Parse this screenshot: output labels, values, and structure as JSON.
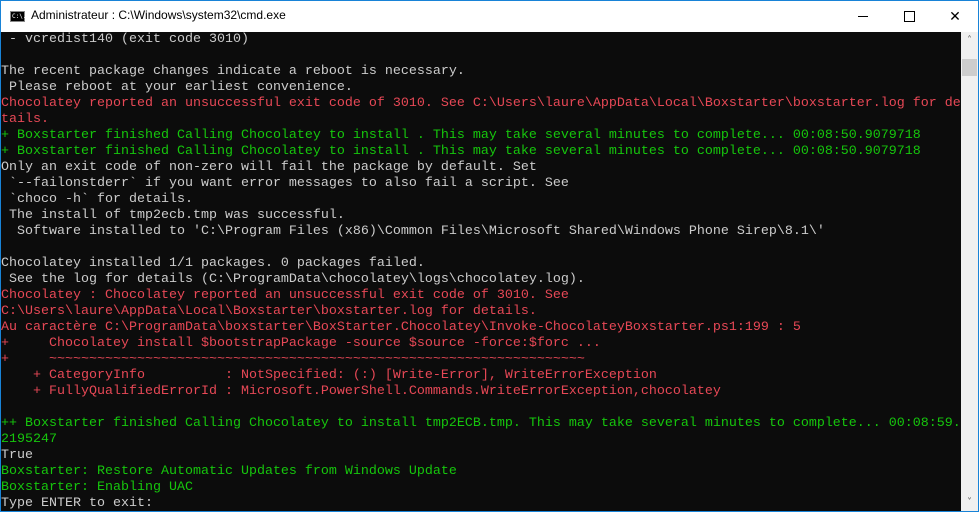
{
  "window": {
    "title": "Administrateur : C:\\Windows\\system32\\cmd.exe",
    "icon": "cmd-icon",
    "icon_text": "C:\\."
  },
  "controls": {
    "minimize": "minimize-icon",
    "maximize": "maximize-icon",
    "close": "close-icon",
    "close_glyph": "✕"
  },
  "scrollbar": {
    "up": "˄",
    "down": "˅"
  },
  "colors": {
    "background": "#0c0c0c",
    "text": "#cccccc",
    "error": "#e74856",
    "success": "#16c60c",
    "border": "#1883d7"
  },
  "console": {
    "lines": [
      {
        "text": " - vcredist140 (exit code 3010)",
        "color": "default"
      },
      {
        "text": "",
        "color": "default"
      },
      {
        "text": "The recent package changes indicate a reboot is necessary.",
        "color": "default"
      },
      {
        "text": " Please reboot at your earliest convenience.",
        "color": "default"
      },
      {
        "text": "Chocolatey reported an unsuccessful exit code of 3010. See C:\\Users\\laure\\AppData\\Local\\Boxstarter\\boxstarter.log for de",
        "color": "red"
      },
      {
        "text": "tails.",
        "color": "red"
      },
      {
        "text": "+ Boxstarter finished Calling Chocolatey to install . This may take several minutes to complete... 00:08:50.9079718",
        "color": "green"
      },
      {
        "text": "+ Boxstarter finished Calling Chocolatey to install . This may take several minutes to complete... 00:08:50.9079718",
        "color": "green"
      },
      {
        "text": "Only an exit code of non-zero will fail the package by default. Set",
        "color": "default"
      },
      {
        "text": " `--failonstderr` if you want error messages to also fail a script. See",
        "color": "default"
      },
      {
        "text": " `choco -h` for details.",
        "color": "default"
      },
      {
        "text": " The install of tmp2ecb.tmp was successful.",
        "color": "default"
      },
      {
        "text": "  Software installed to 'C:\\Program Files (x86)\\Common Files\\Microsoft Shared\\Windows Phone Sirep\\8.1\\'",
        "color": "default"
      },
      {
        "text": "",
        "color": "default"
      },
      {
        "text": "Chocolatey installed 1/1 packages. 0 packages failed.",
        "color": "default"
      },
      {
        "text": " See the log for details (C:\\ProgramData\\chocolatey\\logs\\chocolatey.log).",
        "color": "default"
      },
      {
        "text": "Chocolatey : Chocolatey reported an unsuccessful exit code of 3010. See",
        "color": "red"
      },
      {
        "text": "C:\\Users\\laure\\AppData\\Local\\Boxstarter\\boxstarter.log for details.",
        "color": "red"
      },
      {
        "text": "Au caractère C:\\ProgramData\\boxstarter\\BoxStarter.Chocolatey\\Invoke-ChocolateyBoxstarter.ps1:199 : 5",
        "color": "red"
      },
      {
        "text": "+     Chocolatey install $bootstrapPackage -source $source -force:$forc ...",
        "color": "red"
      },
      {
        "text": "+     ~~~~~~~~~~~~~~~~~~~~~~~~~~~~~~~~~~~~~~~~~~~~~~~~~~~~~~~~~~~~~~~~~~~",
        "color": "red"
      },
      {
        "text": "    + CategoryInfo          : NotSpecified: (:) [Write-Error], WriteErrorException",
        "color": "red"
      },
      {
        "text": "    + FullyQualifiedErrorId : Microsoft.PowerShell.Commands.WriteErrorException,chocolatey",
        "color": "red"
      },
      {
        "text": "",
        "color": "default"
      },
      {
        "text": "++ Boxstarter finished Calling Chocolatey to install tmp2ECB.tmp. This may take several minutes to complete... 00:08:59.",
        "color": "green"
      },
      {
        "text": "2195247",
        "color": "green"
      },
      {
        "text": "True",
        "color": "default"
      },
      {
        "text": "Boxstarter: Restore Automatic Updates from Windows Update",
        "color": "green"
      },
      {
        "text": "Boxstarter: Enabling UAC",
        "color": "green"
      },
      {
        "text": "Type ENTER to exit:",
        "color": "default"
      }
    ]
  }
}
